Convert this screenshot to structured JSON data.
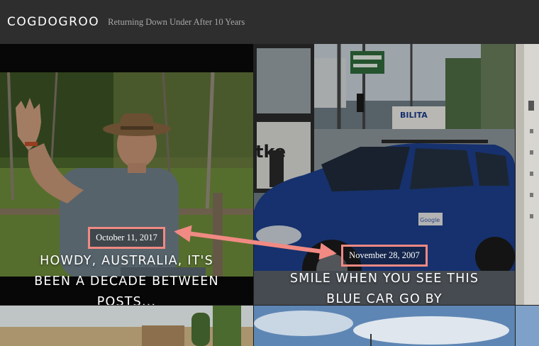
{
  "site": {
    "title": "COGDOGROO",
    "tagline": "Returning Down Under After 10 Years"
  },
  "posts": [
    {
      "date": "October 11, 2017",
      "title_line1": "HOWDY, AUSTRALIA, IT'S",
      "title_line2": "BEEN A DECADE BETWEEN",
      "title_line3": "POSTS..."
    },
    {
      "date": "November 28, 2007",
      "title_line1": "SMILE WHEN YOU SEE THIS",
      "title_line2": "BLUE CAR GO BY"
    }
  ],
  "photo_text": {
    "sign": "BILITA",
    "window": "tke",
    "car_decal": "Google"
  },
  "colors": {
    "header_bg": "#2e2e2e",
    "highlight": "#f08a83",
    "car_blue": "#1d3f8c"
  }
}
